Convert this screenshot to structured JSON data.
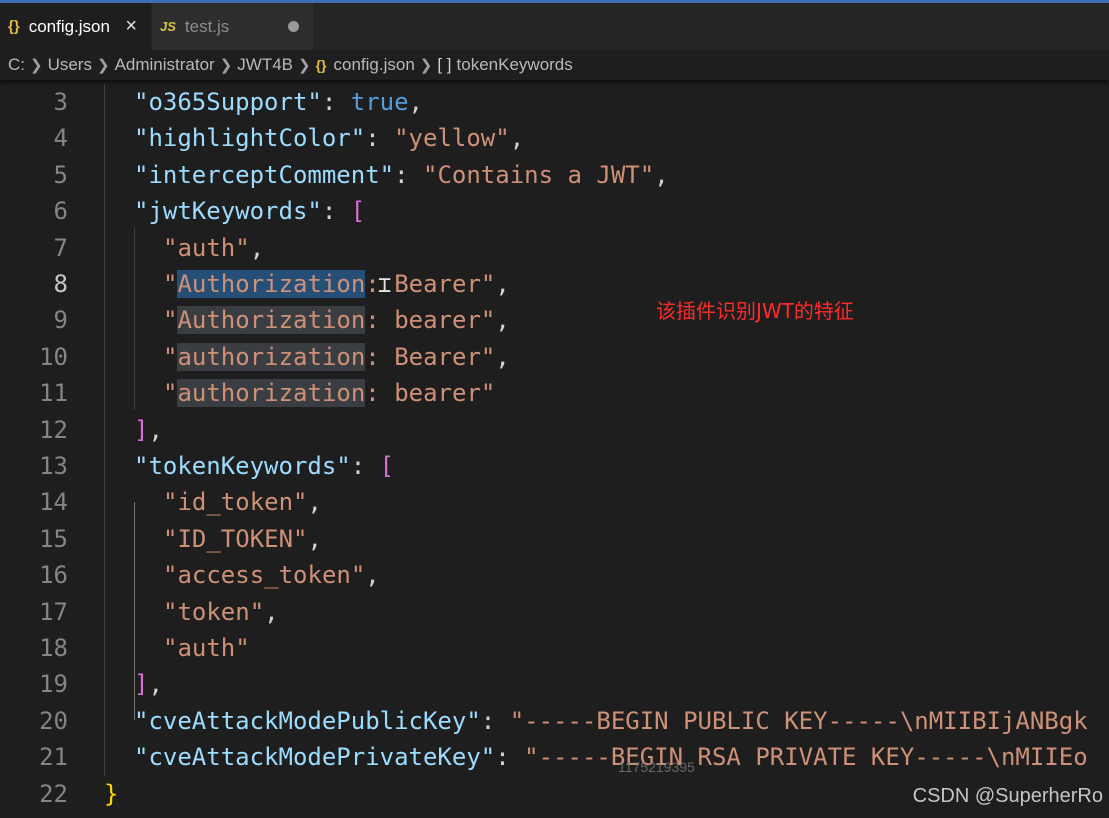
{
  "tabs": [
    {
      "icon": "{}",
      "label": "config.json",
      "state": "active",
      "action": "×"
    },
    {
      "icon": "JS",
      "label": "test.js",
      "state": "modified"
    }
  ],
  "breadcrumb": {
    "drive": "C:",
    "users": "Users",
    "administrator": "Administrator",
    "project": "JWT4B",
    "file_icon": "{}",
    "file": "config.json",
    "symbol_icon": "[ ]",
    "symbol": "tokenKeywords"
  },
  "editor": {
    "current_line": 8,
    "lines": [
      {
        "n": "3"
      },
      {
        "n": "4"
      },
      {
        "n": "5"
      },
      {
        "n": "6"
      },
      {
        "n": "7"
      },
      {
        "n": "8"
      },
      {
        "n": "9"
      },
      {
        "n": "10"
      },
      {
        "n": "11"
      },
      {
        "n": "12"
      },
      {
        "n": "13"
      },
      {
        "n": "14"
      },
      {
        "n": "15"
      },
      {
        "n": "16"
      },
      {
        "n": "17"
      },
      {
        "n": "18"
      },
      {
        "n": "19"
      },
      {
        "n": "20"
      },
      {
        "n": "21"
      },
      {
        "n": "22"
      }
    ],
    "tokens": {
      "o365_key": "\"o365Support\"",
      "true_val": "true",
      "highlight_key": "\"highlightColor\"",
      "yellow_val": "\"yellow\"",
      "intercept_key": "\"interceptComment\"",
      "intercept_val": "\"Contains a JWT\"",
      "jwt_key": "\"jwtKeywords\"",
      "auth": "\"auth\"",
      "kw1_word": "Authorization",
      "kw1_rest": ": Bearer\"",
      "kw2_word": "Authorization",
      "kw2_rest": ": bearer\"",
      "kw3_word": "authorization",
      "kw3_rest": ": Bearer\"",
      "kw4_word": "authorization",
      "kw4_rest": ": bearer\"",
      "token_key": "\"tokenKeywords\"",
      "t1": "\"id_token\"",
      "t2": "\"ID_TOKEN\"",
      "t3": "\"access_token\"",
      "t4": "\"token\"",
      "t5": "\"auth\"",
      "pub_key": "\"cveAttackModePublicKey\"",
      "pub_val": "\"-----BEGIN PUBLIC KEY-----\\nMIIBIjANBgk",
      "priv_key": "\"cveAttackModePrivateKey\"",
      "priv_val": "\"-----BEGIN RSA PRIVATE KEY-----\\nMIIEo",
      "colon": ": ",
      "comma": ",",
      "open_bracket": "[",
      "close_bracket": "]",
      "close_brace": "}",
      "quote": "\""
    }
  },
  "annotation": "该插件识别JWT的特征",
  "watermark_id": "1175219395",
  "watermark_csdn": "CSDN @SuperherRo",
  "colors": {
    "key": "#9cdcfe",
    "string": "#ce9178",
    "boolean": "#569cd6",
    "bracket": "#da70d6",
    "brace": "#ffd700",
    "selection": "#264f78",
    "annotation": "#ff2a2a"
  }
}
